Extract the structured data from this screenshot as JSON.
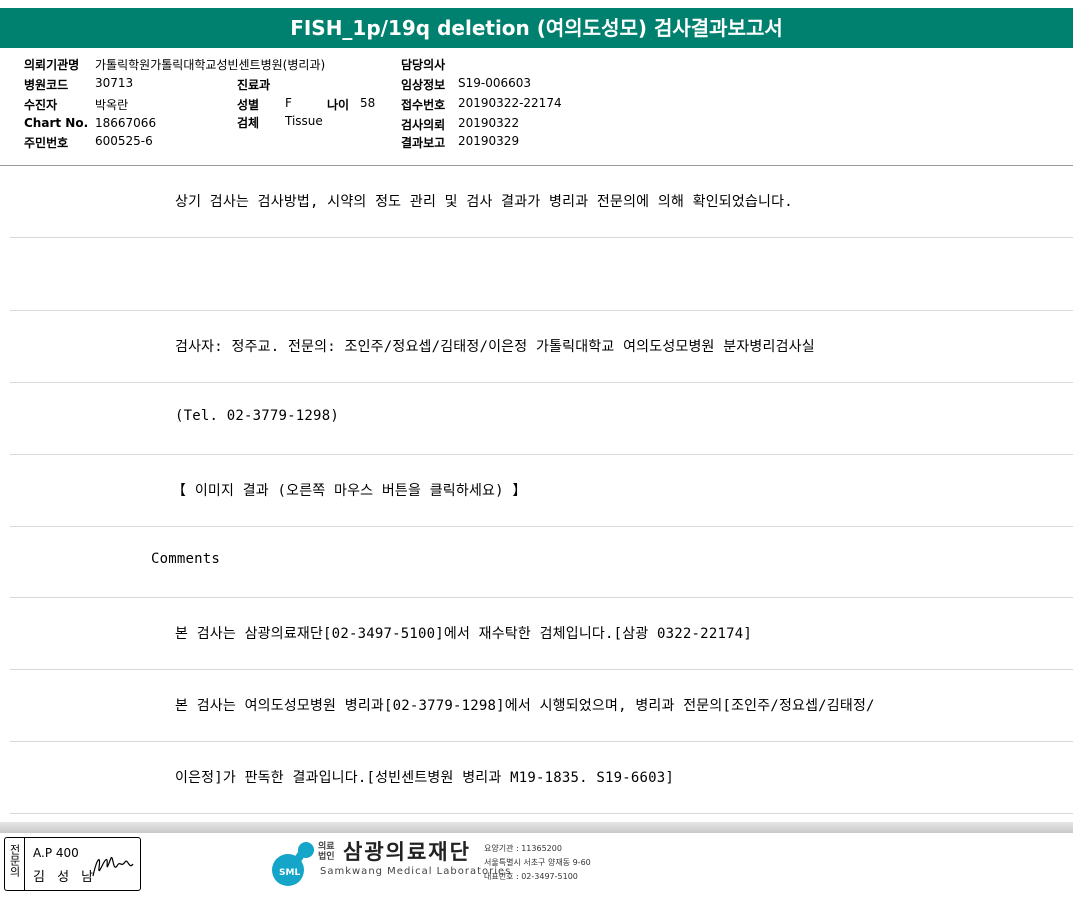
{
  "title": "FISH_1p/19q deletion (여의도성모) 검사결과보고서",
  "header": {
    "institution_label": "의뢰기관명",
    "institution_value": "가톨릭학원가톨릭대학교성빈센트병원(병리과)",
    "hospital_code_label": "병원코드",
    "hospital_code_value": "30713",
    "patient_label": "수진자",
    "patient_value": "박옥란",
    "chart_label": "Chart No.",
    "chart_value": "18667066",
    "ssn_label": "주민번호",
    "ssn_value": "600525-6",
    "dept_label": "진료과",
    "dept_value": "",
    "sex_label": "성별",
    "sex_value": "F",
    "age_label": "나이",
    "age_value": "58",
    "specimen_label": "검체",
    "specimen_value": "Tissue",
    "doctor_label": "담당의사",
    "doctor_value": "",
    "clinical_label": "임상정보",
    "clinical_value": "S19-006603",
    "receipt_label": "접수번호",
    "receipt_value": "20190322-22174",
    "request_label": "검사의뢰",
    "request_value": "20190322",
    "report_label": "결과보고",
    "report_value": "20190329"
  },
  "lines": [
    "상기 검사는 검사방법, 시약의 정도 관리 및 검사 결과가 병리과 전문의에 의해 확인되었습니다.",
    "",
    "검사자: 정주교. 전문의: 조인주/정요셉/김태정/이은정 가톨릭대학교 여의도성모병원 분자병리검사실",
    "(Tel. 02-3779-1298)",
    "【 이미지 결과 (오른쪽 마우스 버튼을 클릭하세요) 】",
    "Comments",
    "본 검사는 삼광의료재단[02-3497-5100]에서 재수탁한 검체입니다.[삼광 0322-22174]",
    "본 검사는 여의도성모병원 병리과[02-3779-1298]에서 시행되었으며, 병리과 전문의[조인주/정요셉/김태정/",
    "이은정]가 판독한 결과입니다.[성빈센트병원 병리과 M19-1835. S19-6603]"
  ],
  "footer": {
    "specialist_label": "전문의",
    "license": "A.P 400",
    "specialist_name": "김 성 남",
    "logo_badge": "SML",
    "org_small": "의료\n법인",
    "org_name": "삼광의료재단",
    "org_en": "Samkwang Medical Laboratories",
    "info1": "요양기관 : 11365200",
    "info2": "서울특별시 서초구 양재동 9-60",
    "info3": "대표번호 : 02-3497-5100"
  },
  "colors": {
    "title_bar": "#00806f",
    "logo": "#14a5c8"
  }
}
